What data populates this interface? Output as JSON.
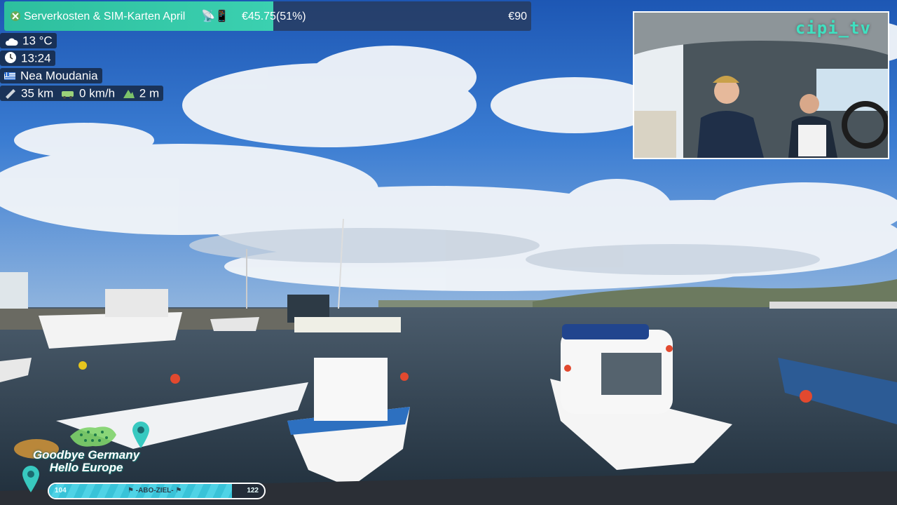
{
  "goal": {
    "title": "Serverkosten & SIM-Karten April",
    "emoji": "📡📱",
    "current": "€45.75(51%)",
    "target": "€90",
    "progress_fraction": 0.51
  },
  "stats": {
    "weather": "13 °C",
    "time": "13:24",
    "location": "Nea Moudania",
    "distance": "35 km",
    "speed": "0 km/h",
    "altitude": "2 m"
  },
  "cam": {
    "brand": "cipi_tv"
  },
  "branding": {
    "line1": "Goodbye Germany",
    "line2": "Hello Europe"
  },
  "route_progress": {
    "start": "104",
    "label": "ABO-ZIEL",
    "end": "122",
    "fraction": 0.85
  },
  "icons": [
    "cloud-icon",
    "clock-icon",
    "greek-flag-icon",
    "ruler-icon",
    "van-icon",
    "mountain-icon",
    "location-pin-icon",
    "flag-icon"
  ],
  "colors": {
    "accent": "#3bd0b0",
    "overlay": "#14223a",
    "progress": "#39c3d8"
  }
}
